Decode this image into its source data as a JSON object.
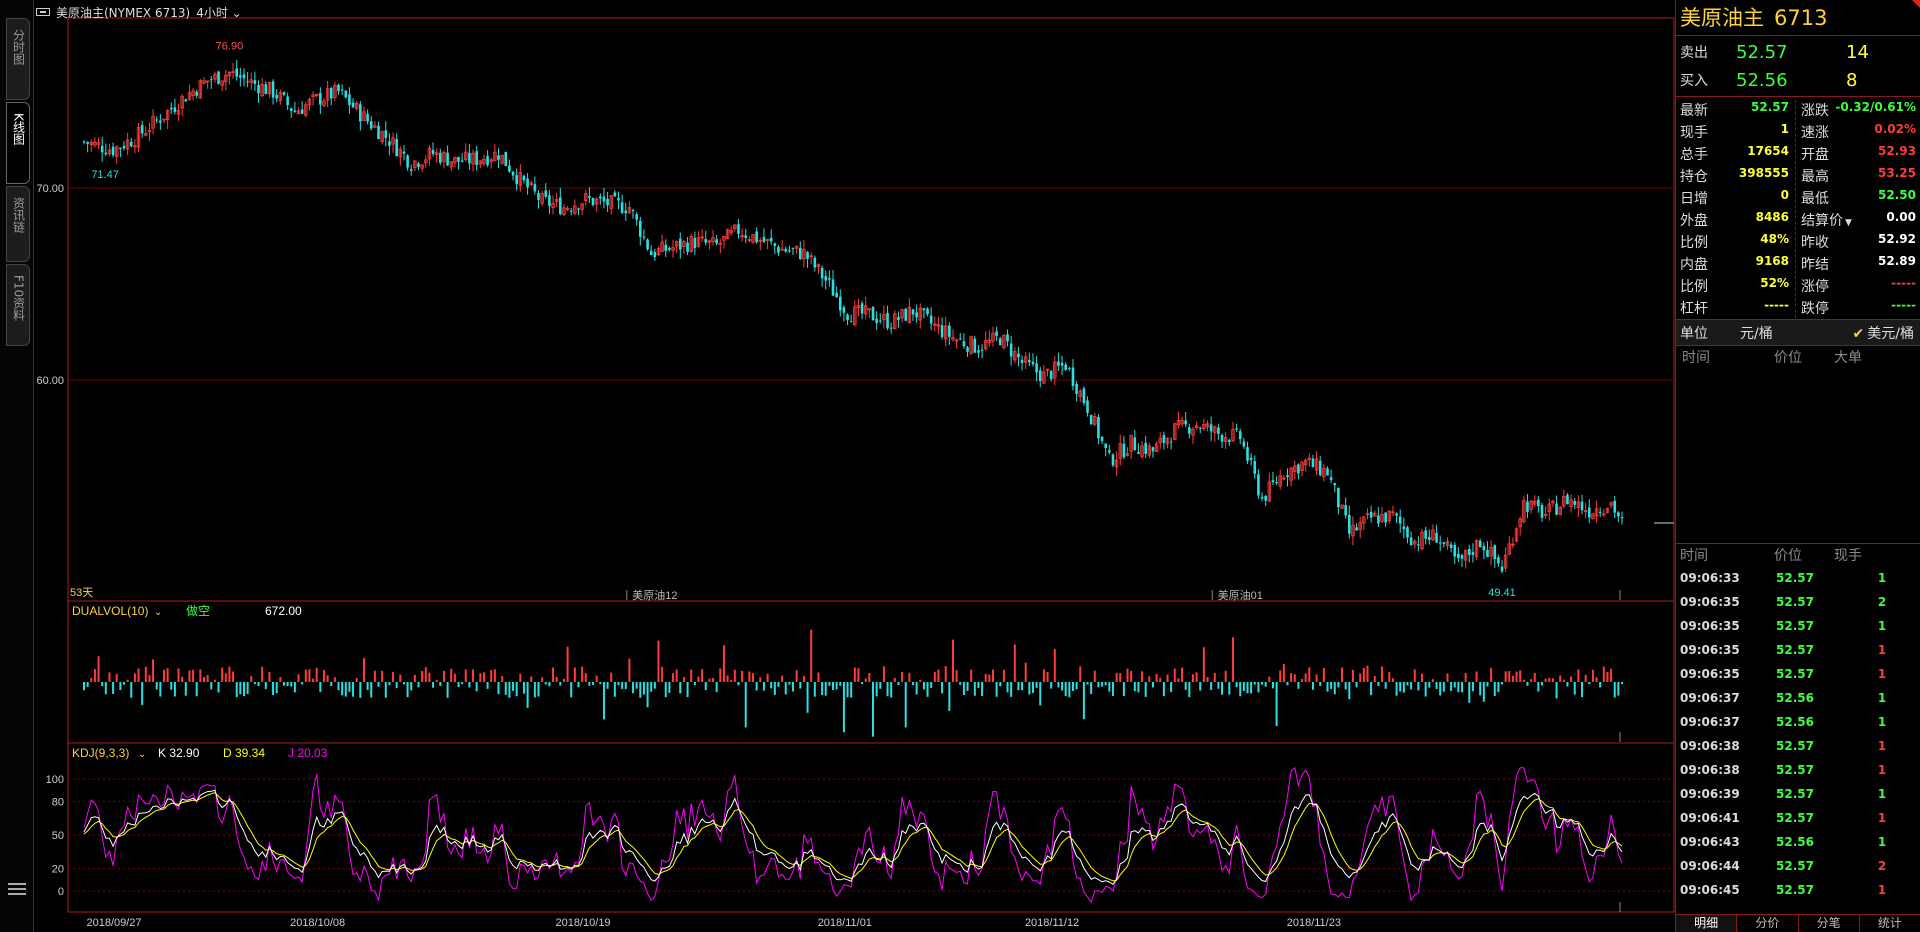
{
  "left_tabs": [
    {
      "label": "分时图",
      "active": false
    },
    {
      "label": "K线图",
      "active": true
    },
    {
      "label": "资讯链",
      "active": false
    },
    {
      "label": "F10资料",
      "active": false
    }
  ],
  "title_bar": {
    "instrument": "美原油主(NYMEX 6713)",
    "period": "4小时"
  },
  "main_panel": {
    "y_ticks": [
      "70.00",
      "60.00"
    ],
    "high_label": "76.90",
    "low_label_left": "71.47",
    "low_label_right": "49.41",
    "contract_labels": [
      "美原油12",
      "美原油01"
    ],
    "days_label": "53天"
  },
  "vol_panel": {
    "name": "DUALVOL(10)",
    "mode": "做空",
    "value": "672.00"
  },
  "kdj_panel": {
    "name": "KDJ(9,3,3)",
    "k_label": "K 32.90",
    "d_label": "D 39.34",
    "j_label": "J 20.03",
    "y_ticks": [
      "100",
      "80",
      "50",
      "20",
      "0"
    ]
  },
  "x_dates": [
    "2018/09/27",
    "2018/10/08",
    "2018/10/19",
    "2018/11/01",
    "2018/11/12",
    "2018/11/23"
  ],
  "colors": {
    "up": "#ff3c3c",
    "down": "#27e1e1",
    "k_line": "#ffffff",
    "d_line": "#ffff00",
    "j_line": "#ff00ff",
    "grid": "#7a0000",
    "border": "#b51a1a"
  },
  "chart_data": {
    "type": "candlestick",
    "price_axis": {
      "ticks": [
        70,
        60
      ],
      "gridlines": true
    },
    "annotations": {
      "high": 76.9,
      "low_start": 71.47,
      "low_end": 49.41
    },
    "close_path": [
      {
        "x": 0,
        "y": 72.4
      },
      {
        "x": 8,
        "y": 72.0
      },
      {
        "x": 14,
        "y": 72.6
      },
      {
        "x": 22,
        "y": 73.8
      },
      {
        "x": 28,
        "y": 74.8
      },
      {
        "x": 34,
        "y": 75.6
      },
      {
        "x": 40,
        "y": 76.0
      },
      {
        "x": 46,
        "y": 75.5
      },
      {
        "x": 52,
        "y": 75.0
      },
      {
        "x": 58,
        "y": 74.0
      },
      {
        "x": 64,
        "y": 74.6
      },
      {
        "x": 70,
        "y": 75.0
      },
      {
        "x": 78,
        "y": 73.5
      },
      {
        "x": 84,
        "y": 72.5
      },
      {
        "x": 90,
        "y": 71.3
      },
      {
        "x": 96,
        "y": 71.8
      },
      {
        "x": 102,
        "y": 71.4
      },
      {
        "x": 108,
        "y": 71.5
      },
      {
        "x": 114,
        "y": 71.8
      },
      {
        "x": 120,
        "y": 70.4
      },
      {
        "x": 126,
        "y": 69.3
      },
      {
        "x": 132,
        "y": 69.0
      },
      {
        "x": 138,
        "y": 69.4
      },
      {
        "x": 144,
        "y": 69.2
      },
      {
        "x": 150,
        "y": 69.0
      },
      {
        "x": 156,
        "y": 66.6
      },
      {
        "x": 162,
        "y": 66.9
      },
      {
        "x": 168,
        "y": 67.2
      },
      {
        "x": 174,
        "y": 67.0
      },
      {
        "x": 180,
        "y": 67.8
      },
      {
        "x": 186,
        "y": 67.3
      },
      {
        "x": 192,
        "y": 66.8
      },
      {
        "x": 198,
        "y": 66.6
      },
      {
        "x": 204,
        "y": 65.2
      },
      {
        "x": 210,
        "y": 63.5
      },
      {
        "x": 216,
        "y": 63.4
      },
      {
        "x": 222,
        "y": 63.0
      },
      {
        "x": 228,
        "y": 63.6
      },
      {
        "x": 234,
        "y": 62.8
      },
      {
        "x": 240,
        "y": 62.1
      },
      {
        "x": 246,
        "y": 61.7
      },
      {
        "x": 252,
        "y": 62.2
      },
      {
        "x": 258,
        "y": 60.9
      },
      {
        "x": 264,
        "y": 60.2
      },
      {
        "x": 270,
        "y": 60.8
      },
      {
        "x": 276,
        "y": 58.6
      },
      {
        "x": 282,
        "y": 55.8
      },
      {
        "x": 288,
        "y": 56.7
      },
      {
        "x": 294,
        "y": 56.3
      },
      {
        "x": 300,
        "y": 57.4
      },
      {
        "x": 306,
        "y": 57.7
      },
      {
        "x": 312,
        "y": 57.2
      },
      {
        "x": 318,
        "y": 57.0
      },
      {
        "x": 324,
        "y": 53.8
      },
      {
        "x": 330,
        "y": 55.2
      },
      {
        "x": 336,
        "y": 55.7
      },
      {
        "x": 342,
        "y": 55.2
      },
      {
        "x": 348,
        "y": 52.0
      },
      {
        "x": 354,
        "y": 52.8
      },
      {
        "x": 360,
        "y": 52.9
      },
      {
        "x": 366,
        "y": 51.6
      },
      {
        "x": 372,
        "y": 51.9
      },
      {
        "x": 378,
        "y": 50.4
      },
      {
        "x": 384,
        "y": 51.6
      },
      {
        "x": 390,
        "y": 50.2
      },
      {
        "x": 396,
        "y": 53.6
      },
      {
        "x": 402,
        "y": 53.0
      },
      {
        "x": 408,
        "y": 53.8
      },
      {
        "x": 414,
        "y": 53.2
      },
      {
        "x": 420,
        "y": 53.6
      },
      {
        "x": 423,
        "y": 52.57
      }
    ]
  },
  "right_panel": {
    "name": "美原油主",
    "code": "6713",
    "sell": {
      "label": "卖出",
      "price": "52.57",
      "vol": "14"
    },
    "buy": {
      "label": "买入",
      "price": "52.56",
      "vol": "8"
    },
    "rows": [
      {
        "l": "最新",
        "lv": "52.57",
        "lc": "c-green",
        "r": "涨跌",
        "rv": "-0.32/0.61%",
        "rc": "c-green"
      },
      {
        "l": "现手",
        "lv": "1",
        "lc": "c-yellow",
        "r": "速涨",
        "rv": "0.02%",
        "rc": "c-red"
      },
      {
        "l": "总手",
        "lv": "17654",
        "lc": "c-yellow",
        "r": "开盘",
        "rv": "52.93",
        "rc": "c-red"
      },
      {
        "l": "持仓",
        "lv": "398555",
        "lc": "c-yellow",
        "r": "最高",
        "rv": "53.25",
        "rc": "c-red"
      },
      {
        "l": "日增",
        "lv": "0",
        "lc": "c-yellow",
        "r": "最低",
        "rv": "52.50",
        "rc": "c-green"
      },
      {
        "l": "外盘",
        "lv": "8486",
        "lc": "c-yellow",
        "r": "结算价",
        "rv": "0.00",
        "rc": "c-white"
      },
      {
        "l": "比例",
        "lv": "48%",
        "lc": "c-yellow",
        "r": "昨收",
        "rv": "52.92",
        "rc": "c-white"
      },
      {
        "l": "内盘",
        "lv": "9168",
        "lc": "c-yellow",
        "r": "昨结",
        "rv": "52.89",
        "rc": "c-white"
      },
      {
        "l": "比例",
        "lv": "52%",
        "lc": "c-yellow",
        "r": "涨停",
        "rv": "-----",
        "rc": "c-dash-red"
      },
      {
        "l": "杠杆",
        "lv": "-----",
        "lc": "c-yellow",
        "r": "跌停",
        "rv": "-----",
        "rc": "c-dash-green"
      }
    ],
    "unit": {
      "label": "单位",
      "opt1": "元/桶",
      "opt2": "美元/桶"
    },
    "big_order_head": [
      "时间",
      "价位",
      "大单"
    ],
    "ticks_head": [
      "时间",
      "价位",
      "现手"
    ],
    "ticks": [
      {
        "t": "09:06:33",
        "p": "52.57",
        "v": "1",
        "c": "#3cff3c"
      },
      {
        "t": "09:06:35",
        "p": "52.57",
        "v": "2",
        "c": "#3cff3c"
      },
      {
        "t": "09:06:35",
        "p": "52.57",
        "v": "1",
        "c": "#3cff3c"
      },
      {
        "t": "09:06:35",
        "p": "52.57",
        "v": "1",
        "c": "#ff3c3c"
      },
      {
        "t": "09:06:35",
        "p": "52.57",
        "v": "1",
        "c": "#ff3c3c"
      },
      {
        "t": "09:06:37",
        "p": "52.56",
        "v": "1",
        "c": "#3cff3c"
      },
      {
        "t": "09:06:37",
        "p": "52.56",
        "v": "1",
        "c": "#3cff3c"
      },
      {
        "t": "09:06:38",
        "p": "52.57",
        "v": "1",
        "c": "#ff3c3c"
      },
      {
        "t": "09:06:38",
        "p": "52.57",
        "v": "1",
        "c": "#ff3c3c"
      },
      {
        "t": "09:06:39",
        "p": "52.57",
        "v": "1",
        "c": "#3cff3c"
      },
      {
        "t": "09:06:41",
        "p": "52.57",
        "v": "1",
        "c": "#ff3c3c"
      },
      {
        "t": "09:06:43",
        "p": "52.56",
        "v": "1",
        "c": "#3cff3c"
      },
      {
        "t": "09:06:44",
        "p": "52.57",
        "v": "2",
        "c": "#ff3c3c"
      },
      {
        "t": "09:06:45",
        "p": "52.57",
        "v": "1",
        "c": "#ff3c3c"
      }
    ],
    "bottom_tabs": [
      "明细",
      "分价",
      "分笔",
      "统计"
    ]
  }
}
